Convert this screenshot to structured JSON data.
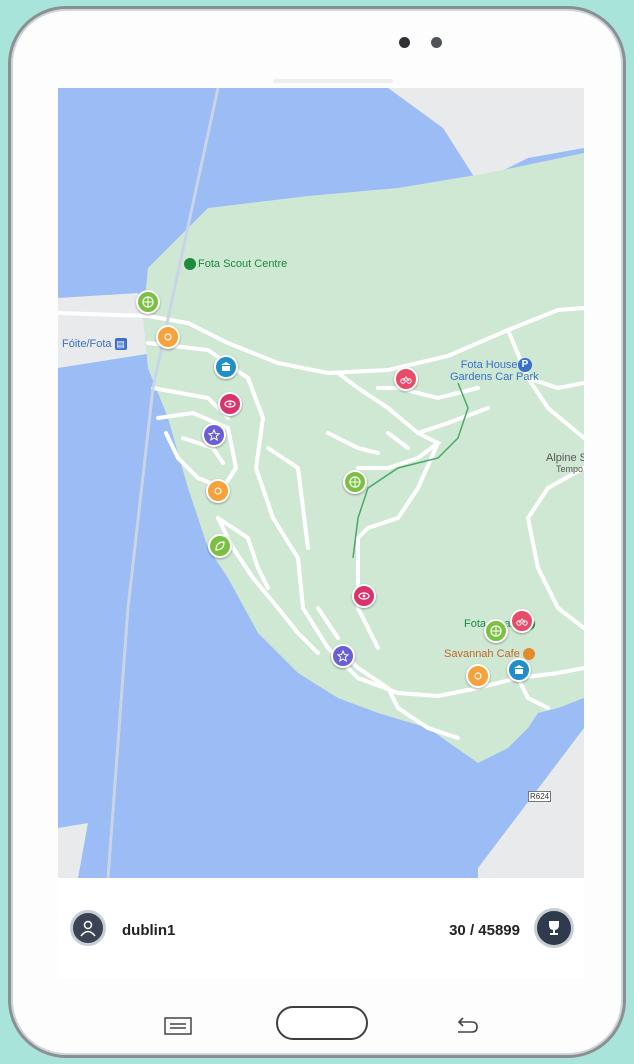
{
  "map": {
    "labels": {
      "scout_centre": "Fota Scout Centre",
      "station": "Fóite/Fota",
      "fota_house_line1": "Fota House &",
      "fota_house_line2": "Gardens Car Park",
      "alpine_line1": "Alpine S",
      "alpine_line2": "Tempo",
      "wildlife_park": "Fota      ark",
      "savannah_cafe": "Savannah Cafe",
      "road_code": "R624"
    },
    "colors": {
      "water": "#9bbcf4",
      "land": "#cfe8d4",
      "road": "#ffffff",
      "label_green": "#1e8a3e",
      "label_blue": "#3b6fc9",
      "label_orange": "#c0692a"
    },
    "markers": [
      {
        "type": "compass",
        "color": "#7bc043",
        "icon": "compass-icon"
      },
      {
        "type": "sun",
        "color": "#f6a13a",
        "icon": "sun-icon"
      },
      {
        "type": "museum",
        "color": "#1f8ec9",
        "icon": "building-icon"
      },
      {
        "type": "eye",
        "color": "#d8336a",
        "icon": "eye-icon"
      },
      {
        "type": "star",
        "color": "#6b5fd6",
        "icon": "star-icon"
      },
      {
        "type": "sun",
        "color": "#f6a13a",
        "icon": "sun-icon"
      },
      {
        "type": "leaf",
        "color": "#7bc043",
        "icon": "leaf-icon"
      },
      {
        "type": "bike",
        "color": "#e84a6a",
        "icon": "bike-icon"
      },
      {
        "type": "compass",
        "color": "#7bc043",
        "icon": "compass-icon"
      },
      {
        "type": "eye",
        "color": "#d8336a",
        "icon": "eye-icon"
      },
      {
        "type": "star",
        "color": "#6b5fd6",
        "icon": "star-icon"
      },
      {
        "type": "bike",
        "color": "#e84a6a",
        "icon": "bike-icon"
      },
      {
        "type": "compass",
        "color": "#7bc043",
        "icon": "compass-icon"
      },
      {
        "type": "museum",
        "color": "#1f8ec9",
        "icon": "building-icon"
      },
      {
        "type": "sun",
        "color": "#f6a13a",
        "icon": "sun-icon"
      }
    ]
  },
  "footer": {
    "username": "dublin1",
    "score": "30 / 45899",
    "profile_icon": "user-icon",
    "trophy_icon": "trophy-icon"
  },
  "device_nav": {
    "menu_icon": "menu-icon",
    "home_icon": "home-button",
    "back_icon": "back-icon"
  }
}
